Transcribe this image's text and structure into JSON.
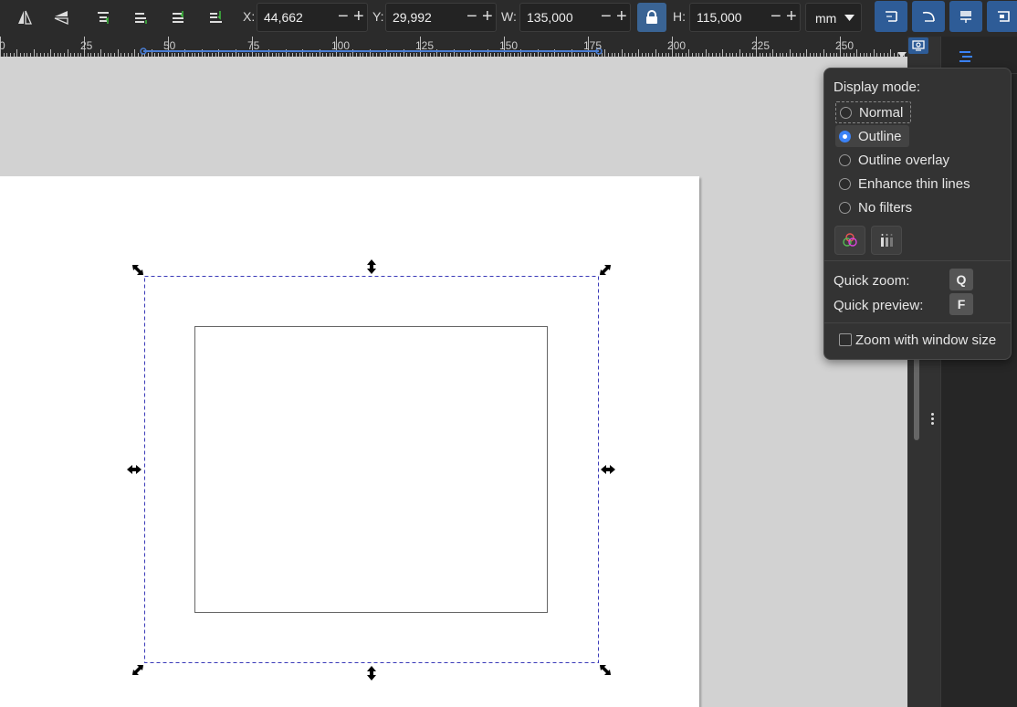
{
  "toolbar": {
    "x_label": "X:",
    "x_value": "44,662",
    "y_label": "Y:",
    "y_value": "29,992",
    "w_label": "W:",
    "w_value": "135,000",
    "h_label": "H:",
    "h_value": "115,000",
    "minus": "−",
    "plus": "+",
    "unit": "mm"
  },
  "ruler": {
    "labels": [
      "0",
      "25",
      "50",
      "75",
      "100",
      "125",
      "150",
      "175",
      "200",
      "225",
      "250"
    ]
  },
  "display_popup": {
    "heading": "Display mode:",
    "modes": [
      {
        "label": "Normal",
        "selected": false
      },
      {
        "label": "Outline",
        "selected": true
      },
      {
        "label": "Outline overlay",
        "selected": false
      },
      {
        "label": "Enhance thin lines",
        "selected": false
      },
      {
        "label": "No filters",
        "selected": false
      }
    ],
    "quick_zoom_label": "Quick zoom:",
    "quick_zoom_key": "Q",
    "quick_preview_label": "Quick preview:",
    "quick_preview_key": "F",
    "zoom_window_label": "Zoom with window size",
    "zoom_window_checked": false
  },
  "colors": {
    "accent": "#3b82f6",
    "selection_dash": "#3a3ab8",
    "toolbar_bg": "#2b2b2b",
    "canvas_bg": "#d2d2d2"
  },
  "icons": {
    "flip_h": "flip-horizontal-icon",
    "flip_v": "flip-vertical-icon",
    "raise_top": "raise-to-top-icon",
    "raise": "raise-icon",
    "lower": "lower-icon",
    "lower_bottom": "lower-to-bottom-icon",
    "lock": "lock-icon",
    "display_mode": "display-mode-icon",
    "color_mode": "color-mode-icon",
    "grayscale": "grayscale-icon"
  }
}
